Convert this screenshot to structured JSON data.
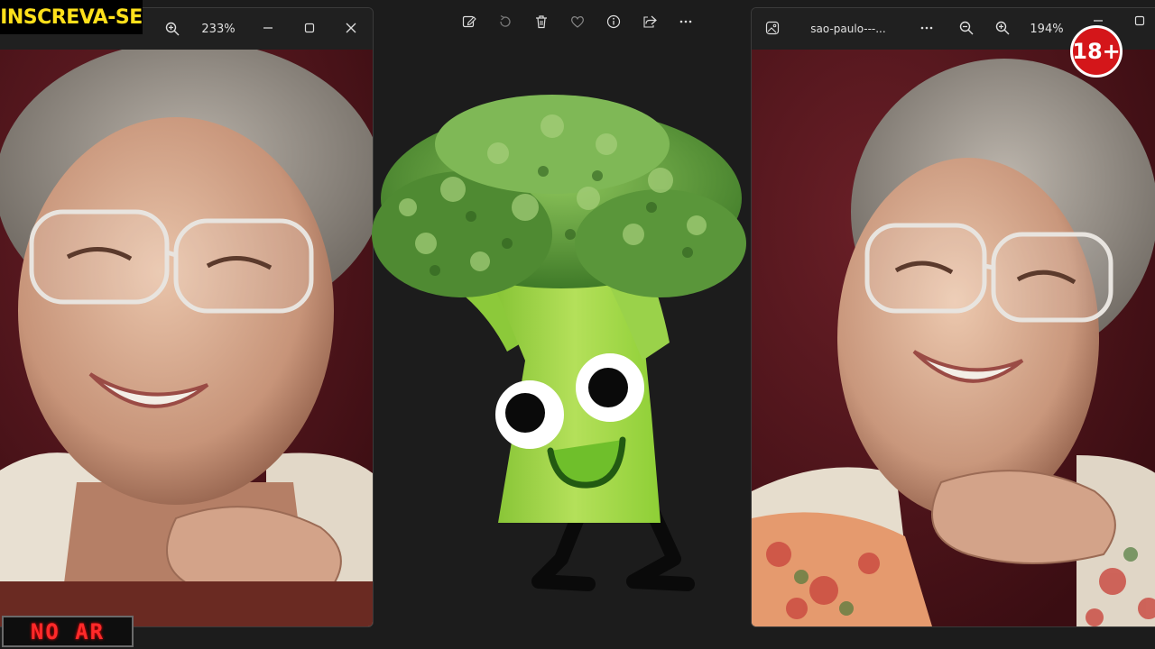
{
  "left_viewer": {
    "zoom_level": "233%",
    "icons": [
      "zoom-in-icon",
      "minimize-icon",
      "maximize-icon",
      "close-icon"
    ]
  },
  "center_viewer": {
    "toolbar_icons": [
      "edit-image-icon",
      "rotate-icon",
      "delete-icon",
      "favorite-icon",
      "info-icon",
      "share-icon",
      "more-options-icon"
    ]
  },
  "right_viewer": {
    "file_name": "sao-paulo---...",
    "zoom_level": "194%",
    "icons": [
      "gallery-icon",
      "more-options-icon",
      "zoom-out-icon",
      "zoom-in-icon",
      "minimize-icon",
      "maximize-icon"
    ]
  },
  "overlays": {
    "subscribe_label": "INSCREVA-SE",
    "age_rating": "18+",
    "live_label": "NO AR"
  },
  "colors": {
    "photo_bg": "#5a1820",
    "subscribe_text": "#ffe01b",
    "age_badge": "#d4161a",
    "live_text": "#ff2a2a",
    "broccoli": "#7fc33a"
  }
}
